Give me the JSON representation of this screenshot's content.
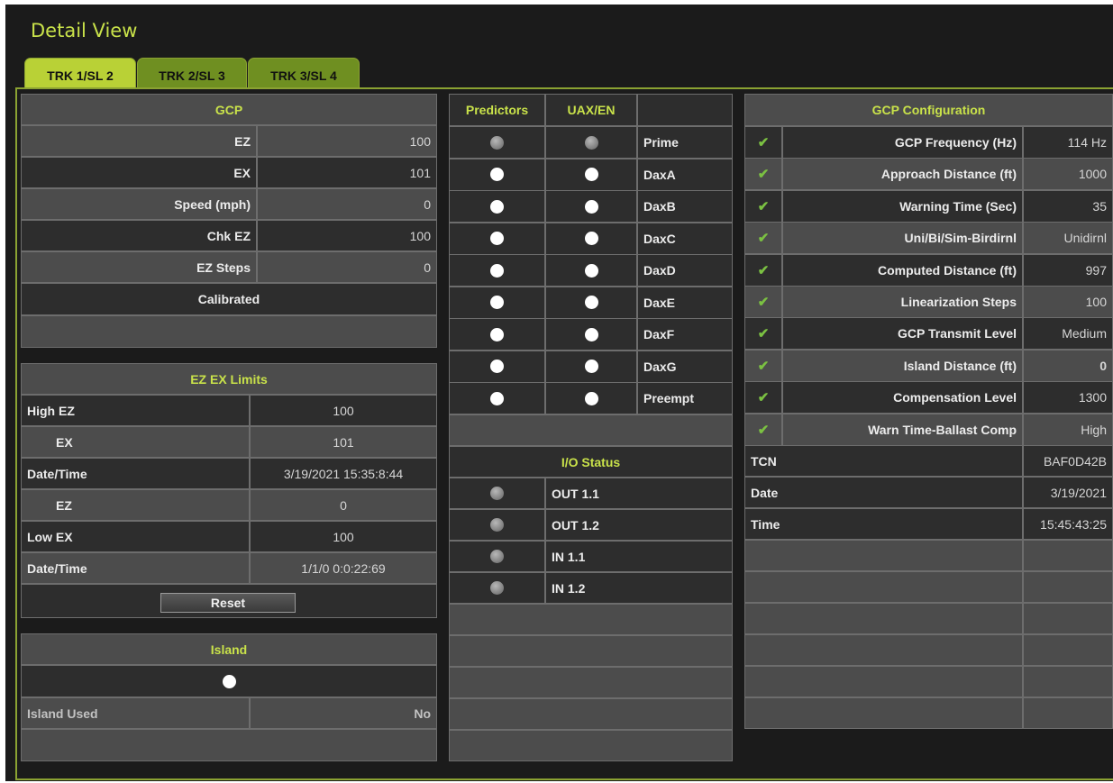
{
  "title": "Detail View",
  "tabs": [
    "TRK 1/SL 2",
    "TRK 2/SL 3",
    "TRK 3/SL 4"
  ],
  "gcp": {
    "header": "GCP",
    "rows": [
      {
        "label": "EZ",
        "value": "100"
      },
      {
        "label": "EX",
        "value": "101"
      },
      {
        "label": "Speed (mph)",
        "value": "0"
      },
      {
        "label": "Chk EZ",
        "value": "100"
      },
      {
        "label": "EZ Steps",
        "value": "0"
      }
    ],
    "status": "Calibrated"
  },
  "limits": {
    "header": "EZ EX Limits",
    "rows": [
      {
        "label": "High EZ",
        "value": "100"
      },
      {
        "label": "EX",
        "value": "101"
      },
      {
        "label": "Date/Time",
        "value": "3/19/2021 15:35:8:44"
      },
      {
        "label": "EZ",
        "value": "0"
      },
      {
        "label": "Low EX",
        "value": "100"
      },
      {
        "label": "Date/Time",
        "value": "1/1/0 0:0:22:69"
      }
    ],
    "reset_label": "Reset"
  },
  "island": {
    "header": "Island",
    "used_label": "Island Used",
    "used_value": "No"
  },
  "predictors": {
    "headers": [
      "Predictors",
      "UAX/EN"
    ],
    "rows": [
      "Prime",
      "DaxA",
      "DaxB",
      "DaxC",
      "DaxD",
      "DaxE",
      "DaxF",
      "DaxG",
      "Preempt"
    ]
  },
  "io": {
    "header": "I/O Status",
    "rows": [
      "OUT 1.1",
      "OUT 1.2",
      "IN 1.1",
      "IN 1.2"
    ]
  },
  "config": {
    "header": "GCP Configuration",
    "rows": [
      {
        "label": "GCP Frequency (Hz)",
        "value": "114 Hz"
      },
      {
        "label": "Approach Distance (ft)",
        "value": "1000"
      },
      {
        "label": "Warning Time (Sec)",
        "value": "35"
      },
      {
        "label": "Uni/Bi/Sim-Birdirnl",
        "value": "Unidirnl"
      },
      {
        "label": "Computed Distance (ft)",
        "value": "997"
      },
      {
        "label": "Linearization Steps",
        "value": "100"
      },
      {
        "label": "GCP Transmit Level",
        "value": "Medium"
      },
      {
        "label": "Island Distance (ft)",
        "value": "0"
      },
      {
        "label": "Compensation Level",
        "value": "1300"
      },
      {
        "label": "Warn Time-Ballast Comp",
        "value": "High"
      }
    ],
    "info": [
      {
        "label": "TCN",
        "value": "BAF0D42B"
      },
      {
        "label": "Date",
        "value": "3/19/2021"
      },
      {
        "label": "Time",
        "value": "15:45:43:25"
      }
    ]
  },
  "colors": {
    "accent": "#c9e24a",
    "tab_active": "#b9d136",
    "tab_inactive": "#6f8f21",
    "check": "#7bc142",
    "row_light": "#4c4c4c",
    "row_dark": "#2d2d2d"
  }
}
